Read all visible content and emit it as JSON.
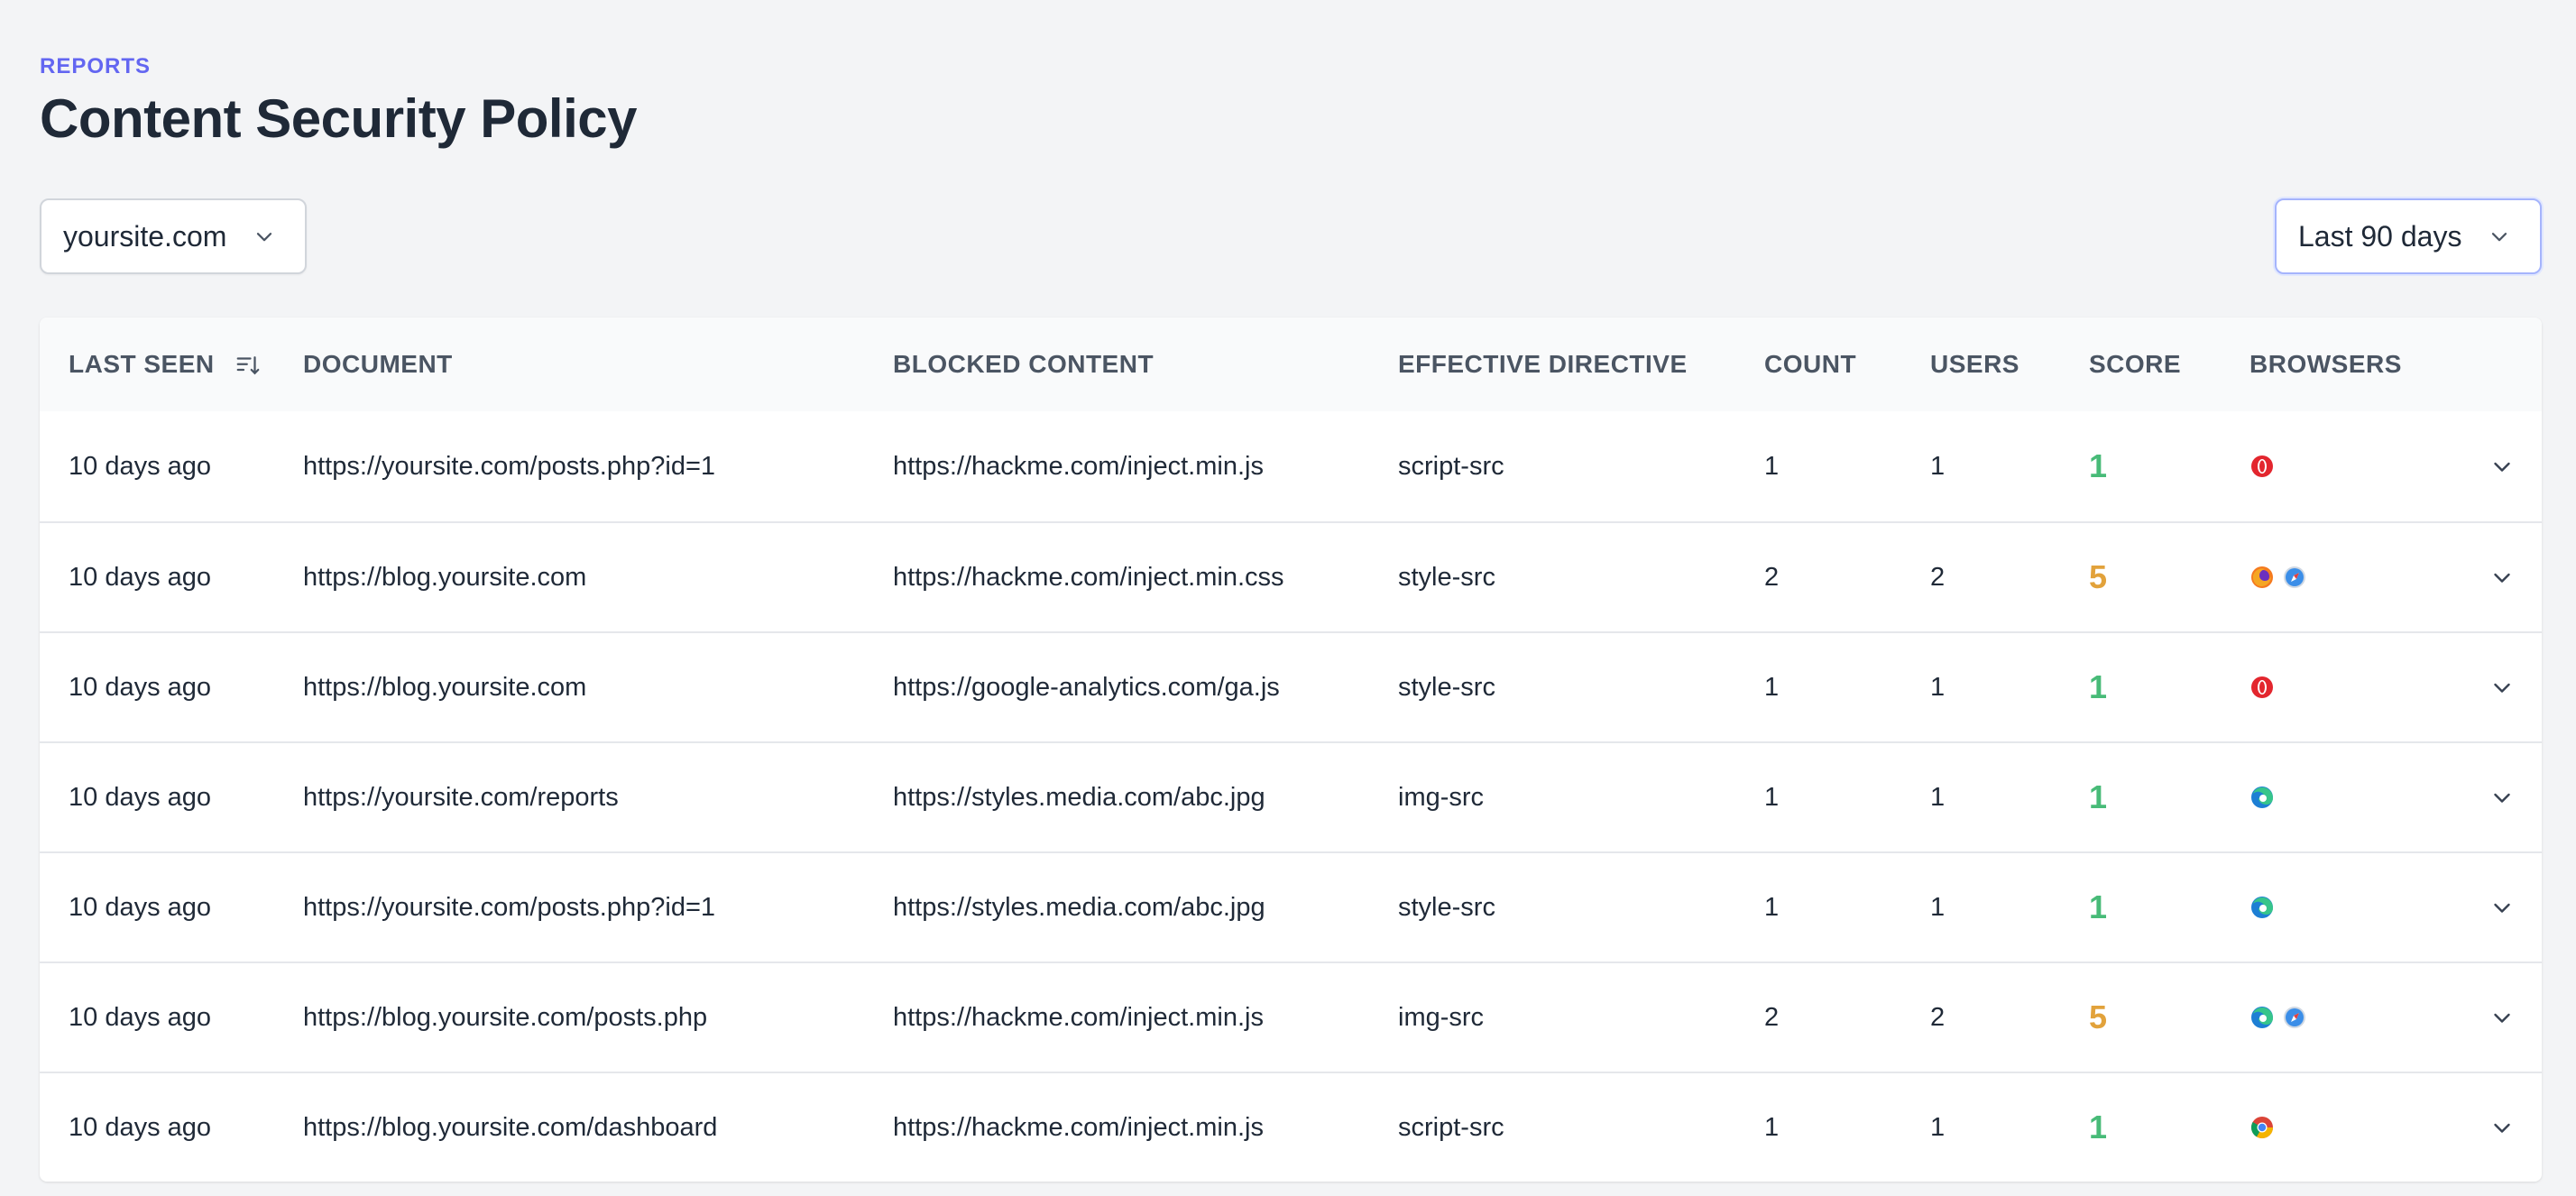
{
  "header": {
    "eyebrow": "REPORTS",
    "title": "Content Security Policy"
  },
  "filters": {
    "site": "yoursite.com",
    "range": "Last 90 days"
  },
  "table": {
    "columns": {
      "last_seen": "LAST SEEN",
      "document": "DOCUMENT",
      "blocked": "BLOCKED CONTENT",
      "directive": "EFFECTIVE DIRECTIVE",
      "count": "COUNT",
      "users": "USERS",
      "score": "SCORE",
      "browsers": "BROWSERS"
    },
    "rows": [
      {
        "last_seen": "10 days ago",
        "document": "https://yoursite.com/posts.php?id=1",
        "blocked": "https://hackme.com/inject.min.js",
        "directive": "script-src",
        "count": "1",
        "users": "1",
        "score": "1",
        "score_level": "good",
        "browsers": [
          "opera-icon"
        ]
      },
      {
        "last_seen": "10 days ago",
        "document": "https://blog.yoursite.com",
        "blocked": "https://hackme.com/inject.min.css",
        "directive": "style-src",
        "count": "2",
        "users": "2",
        "score": "5",
        "score_level": "warn",
        "browsers": [
          "firefox-icon",
          "safari-icon"
        ]
      },
      {
        "last_seen": "10 days ago",
        "document": "https://blog.yoursite.com",
        "blocked": "https://google-analytics.com/ga.js",
        "directive": "style-src",
        "count": "1",
        "users": "1",
        "score": "1",
        "score_level": "good",
        "browsers": [
          "opera-icon"
        ]
      },
      {
        "last_seen": "10 days ago",
        "document": "https://yoursite.com/reports",
        "blocked": "https://styles.media.com/abc.jpg",
        "directive": "img-src",
        "count": "1",
        "users": "1",
        "score": "1",
        "score_level": "good",
        "browsers": [
          "edge-icon"
        ]
      },
      {
        "last_seen": "10 days ago",
        "document": "https://yoursite.com/posts.php?id=1",
        "blocked": "https://styles.media.com/abc.jpg",
        "directive": "style-src",
        "count": "1",
        "users": "1",
        "score": "1",
        "score_level": "good",
        "browsers": [
          "edge-icon"
        ]
      },
      {
        "last_seen": "10 days ago",
        "document": "https://blog.yoursite.com/posts.php",
        "blocked": "https://hackme.com/inject.min.js",
        "directive": "img-src",
        "count": "2",
        "users": "2",
        "score": "5",
        "score_level": "warn",
        "browsers": [
          "edge-icon",
          "safari-icon"
        ]
      },
      {
        "last_seen": "10 days ago",
        "document": "https://blog.yoursite.com/dashboard",
        "blocked": "https://hackme.com/inject.min.js",
        "directive": "script-src",
        "count": "1",
        "users": "1",
        "score": "1",
        "score_level": "good",
        "browsers": [
          "chrome-icon"
        ]
      }
    ]
  },
  "colors": {
    "accent": "#6366f1",
    "score_good": "#48bb78",
    "score_warn": "#e2a23b"
  }
}
